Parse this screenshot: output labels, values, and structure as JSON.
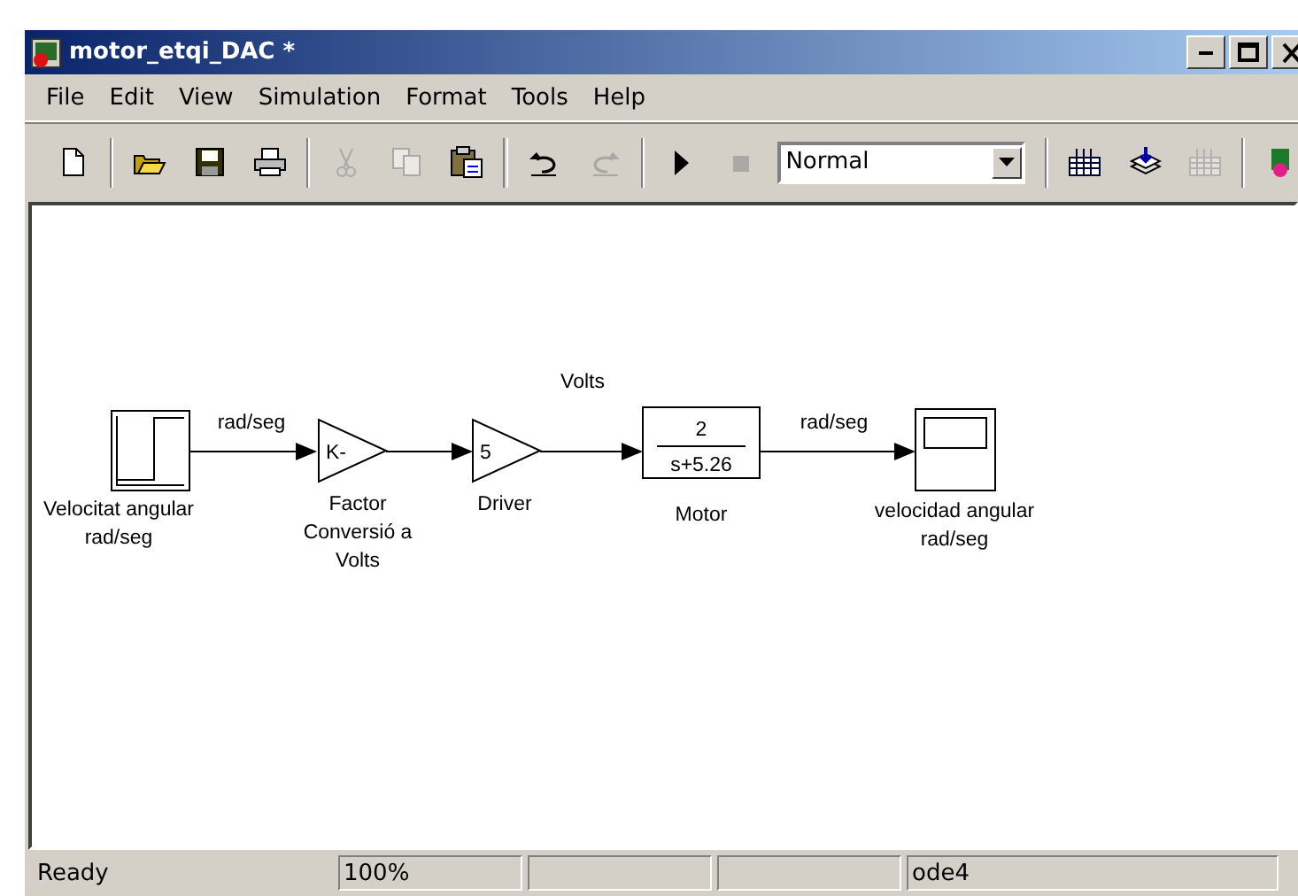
{
  "window": {
    "title": "motor_etqi_DAC *"
  },
  "menu": [
    {
      "label": "File"
    },
    {
      "label": "Edit"
    },
    {
      "label": "View"
    },
    {
      "label": "Simulation"
    },
    {
      "label": "Format"
    },
    {
      "label": "Tools"
    },
    {
      "label": "Help"
    }
  ],
  "toolbar": {
    "buttons": [
      {
        "kind": "new",
        "disabled": false
      },
      {
        "kind": "sep"
      },
      {
        "kind": "open",
        "disabled": false
      },
      {
        "kind": "save",
        "disabled": false
      },
      {
        "kind": "print",
        "disabled": false
      },
      {
        "kind": "sep"
      },
      {
        "kind": "cut",
        "disabled": true
      },
      {
        "kind": "copy",
        "disabled": true
      },
      {
        "kind": "paste",
        "disabled": false
      },
      {
        "kind": "sep"
      },
      {
        "kind": "undo",
        "disabled": false
      },
      {
        "kind": "redo",
        "disabled": true
      },
      {
        "kind": "sep"
      },
      {
        "kind": "start",
        "disabled": false
      },
      {
        "kind": "stop",
        "disabled": true
      },
      {
        "kind": "mode",
        "value": "Normal"
      },
      {
        "kind": "sep"
      },
      {
        "kind": "build",
        "disabled": false
      },
      {
        "kind": "update",
        "disabled": false
      },
      {
        "kind": "grid",
        "disabled": true
      },
      {
        "kind": "sep"
      },
      {
        "kind": "library",
        "disabled": false
      }
    ]
  },
  "diagram": {
    "blocks": [
      {
        "kind": "step",
        "label": [
          "Velocitat angular",
          "rad/seg"
        ]
      },
      {
        "kind": "gain",
        "value": "K-",
        "label": [
          "Factor",
          "Conversió a",
          "Volts"
        ]
      },
      {
        "kind": "gain",
        "value": "5",
        "label": [
          "Driver"
        ]
      },
      {
        "kind": "transfer_fn",
        "numerator": "2",
        "denominator": "s+5.26",
        "label": [
          "Motor"
        ]
      },
      {
        "kind": "scope",
        "label": [
          "velocidad angular",
          "rad/seg"
        ]
      }
    ],
    "signal_labels": [
      "rad/seg",
      "Volts",
      "rad/seg"
    ]
  },
  "status_bar": {
    "status": "Ready",
    "zoom": "100%",
    "solver": "ode4"
  }
}
